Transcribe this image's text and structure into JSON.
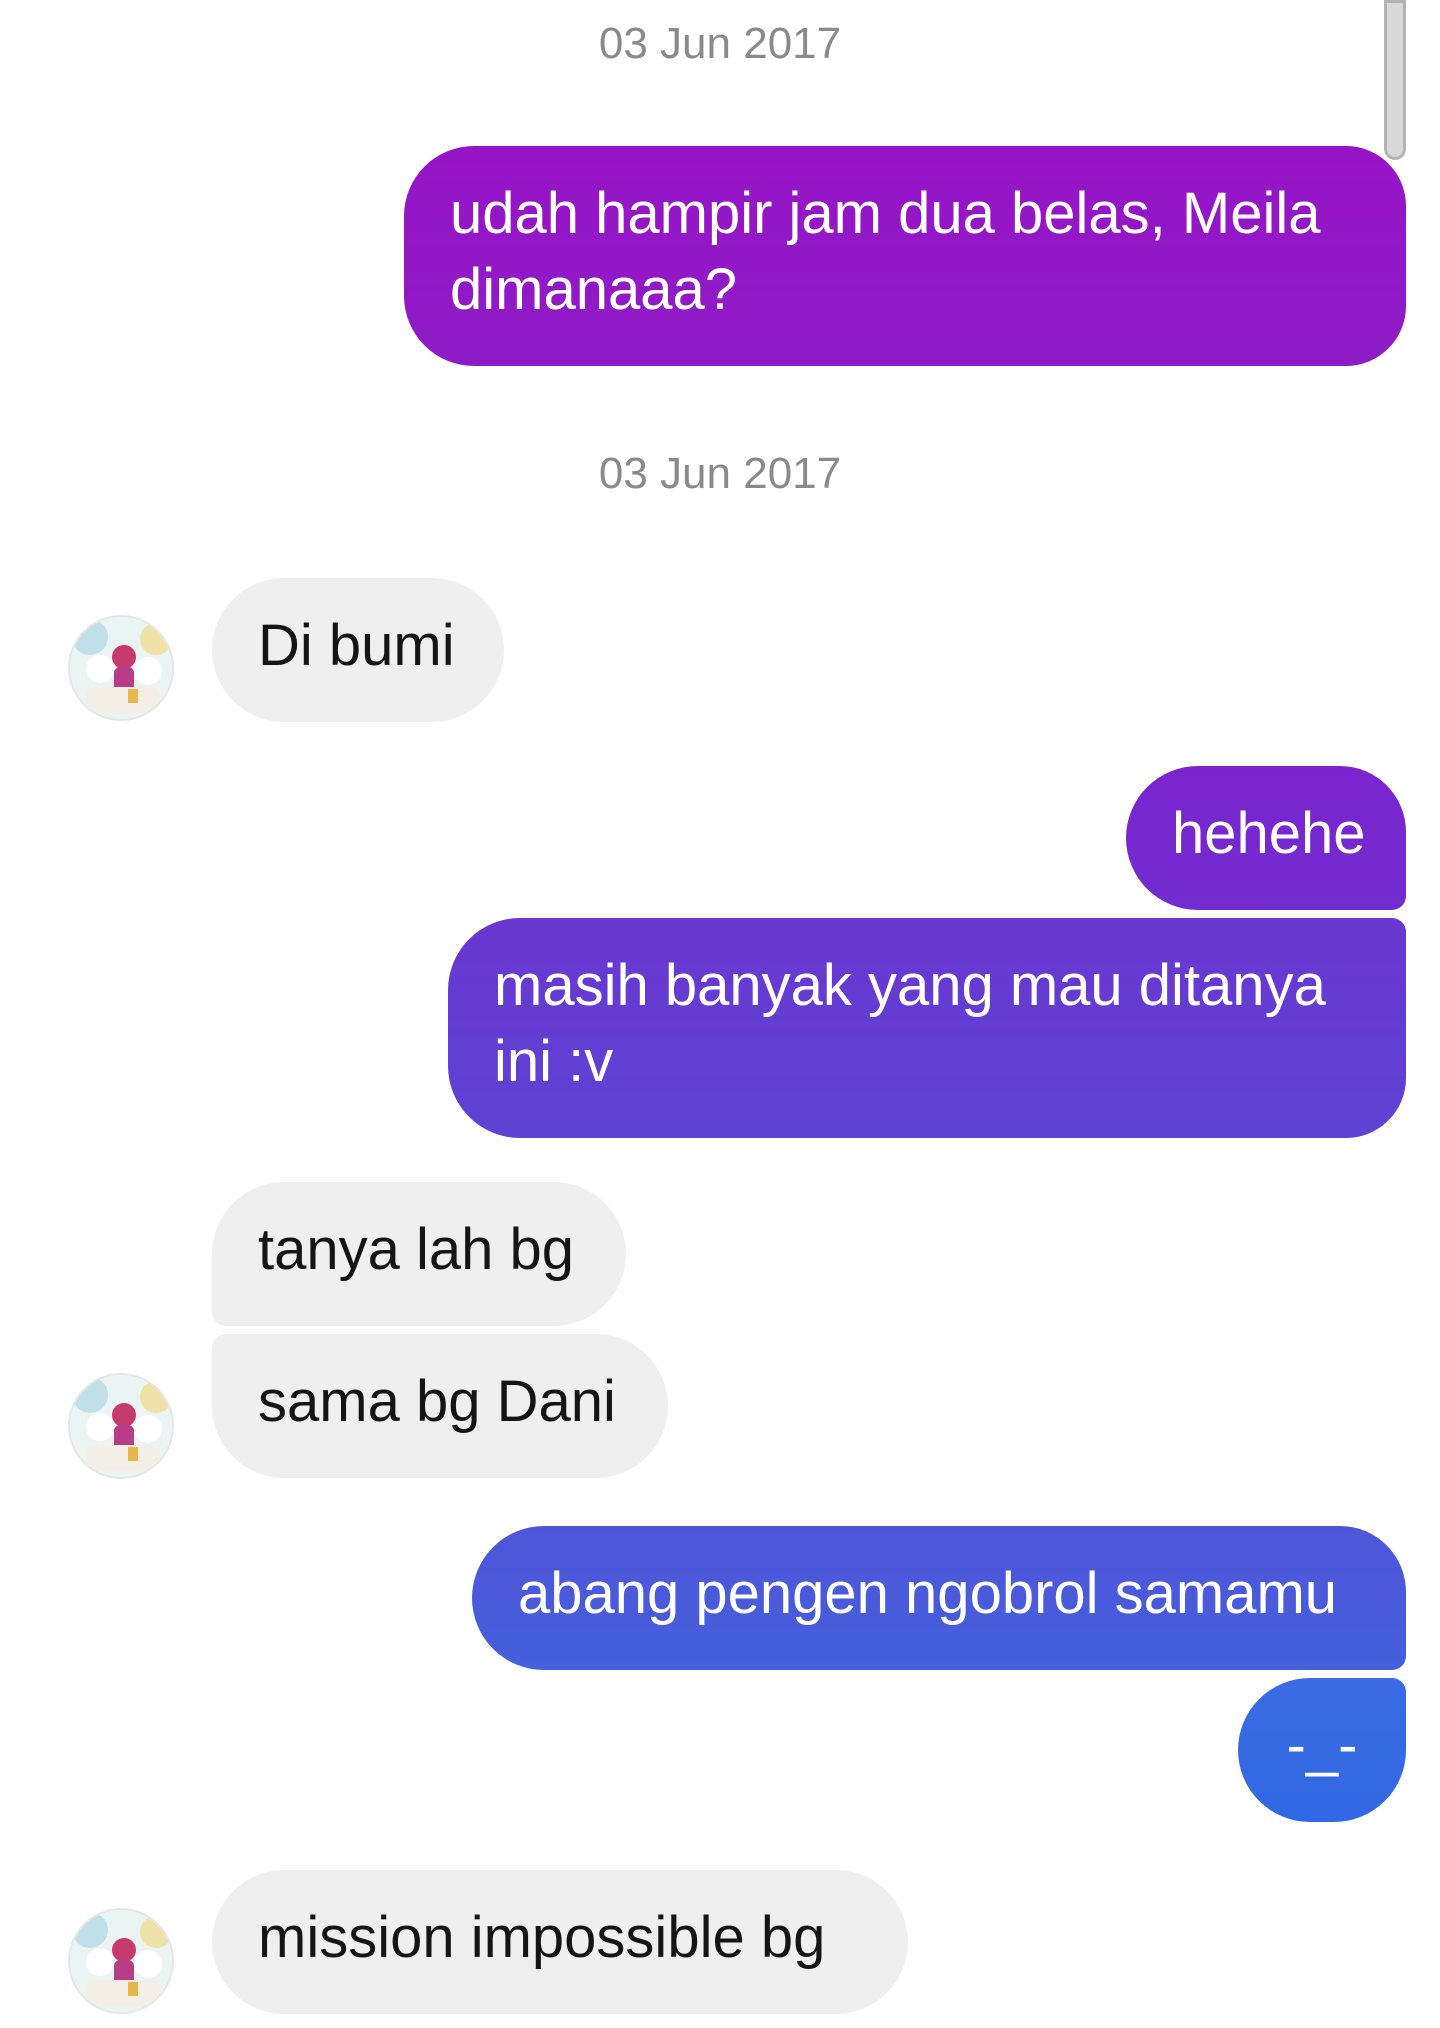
{
  "timestamps": [
    "03 Jun 2017",
    "03 Jun 2017"
  ],
  "messages": [
    {
      "from": "me",
      "text": "udah hampir jam dua belas, Meila\ndimanaaa?"
    },
    {
      "from": "them",
      "text": "Di bumi"
    },
    {
      "from": "me",
      "text": "hehehe"
    },
    {
      "from": "me",
      "text": "masih banyak yang mau ditanya\nini :v"
    },
    {
      "from": "them",
      "text": "tanya lah bg"
    },
    {
      "from": "them",
      "text": "sama bg Dani"
    },
    {
      "from": "me",
      "text": "abang pengen ngobrol samamu"
    },
    {
      "from": "me",
      "text": "-_-"
    },
    {
      "from": "them",
      "text": "mission impossible bg"
    }
  ],
  "colors": {
    "outgoing_gradient_top": "#9a15c4",
    "outgoing_gradient_bottom": "#3167e3",
    "incoming_bubble": "#efefef",
    "timestamp_text": "#8a8a8a"
  }
}
